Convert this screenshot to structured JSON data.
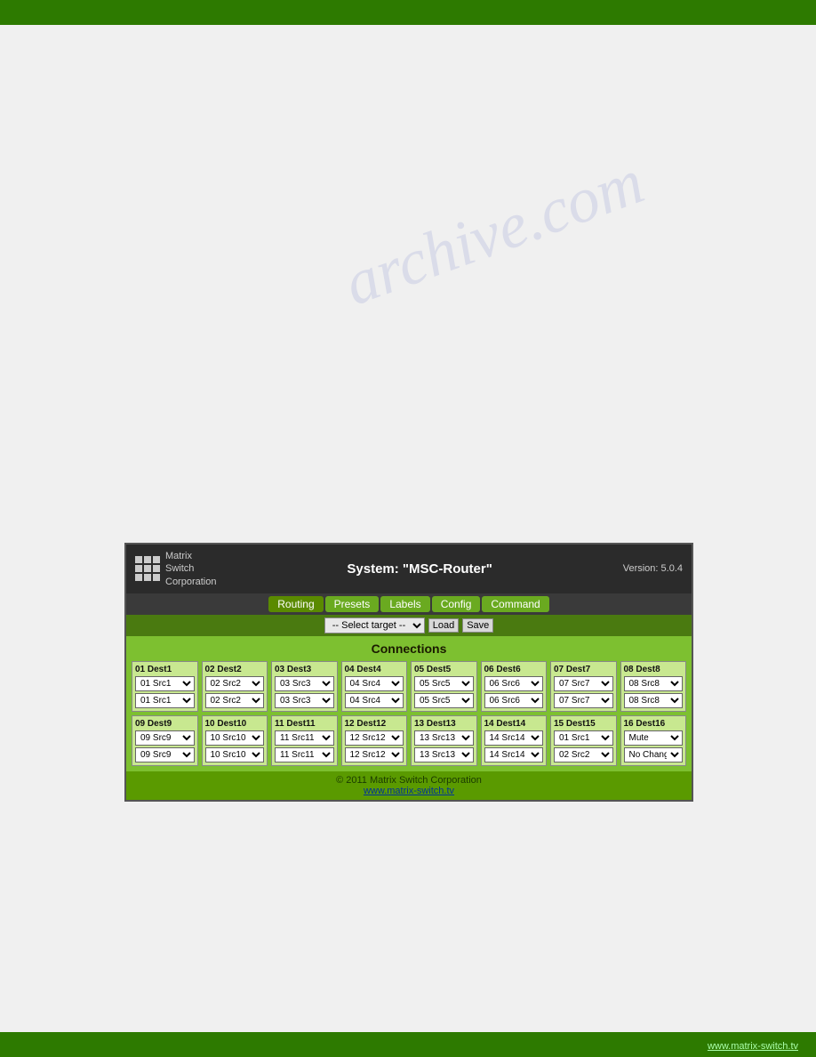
{
  "topBar": {},
  "bottomBar": {
    "text": "www.matrix-switch.tv"
  },
  "watermark": "archive.com",
  "panel": {
    "systemTitle": "System: \"MSC-Router\"",
    "version": "Version: 5.0.4",
    "logo": {
      "lines": [
        "Matrix",
        "Switch",
        "Corporation"
      ]
    },
    "nav": {
      "tabs": [
        {
          "label": "Routing",
          "active": true
        },
        {
          "label": "Presets",
          "active": false
        },
        {
          "label": "Labels",
          "active": false
        },
        {
          "label": "Config",
          "active": false
        },
        {
          "label": "Command",
          "active": false
        }
      ]
    },
    "toolbar": {
      "selectLabel": "-- Select target --",
      "loadButton": "Load",
      "saveButton": "Save"
    },
    "connections": {
      "title": "Connections",
      "destinations": [
        {
          "label": "01 Dest1",
          "selects": [
            "01 Src1",
            "01 Src1"
          ]
        },
        {
          "label": "02 Dest2",
          "selects": [
            "02 Src2",
            "02 Src2"
          ]
        },
        {
          "label": "03 Dest3",
          "selects": [
            "03 Src3",
            "03 Src3"
          ]
        },
        {
          "label": "04 Dest4",
          "selects": [
            "04 Src4",
            "04 Src4"
          ]
        },
        {
          "label": "05 Dest5",
          "selects": [
            "05 Src5",
            "05 Src5"
          ]
        },
        {
          "label": "06 Dest6",
          "selects": [
            "06 Src6",
            "06 Src6"
          ]
        },
        {
          "label": "07 Dest7",
          "selects": [
            "07 Src7",
            "07 Src7"
          ]
        },
        {
          "label": "08 Dest8",
          "selects": [
            "08 Src8",
            "08 Src8"
          ]
        },
        {
          "label": "09 Dest9",
          "selects": [
            "09 Src9",
            "09 Src9"
          ]
        },
        {
          "label": "10 Dest10",
          "selects": [
            "10 Src10",
            "10 Src10"
          ]
        },
        {
          "label": "11 Dest11",
          "selects": [
            "11 Src11",
            "11 Src11"
          ]
        },
        {
          "label": "12 Dest12",
          "selects": [
            "12 Src12",
            "12 Src12"
          ]
        },
        {
          "label": "13 Dest13",
          "selects": [
            "13 Src13",
            "13 Src13"
          ]
        },
        {
          "label": "14 Dest14",
          "selects": [
            "14 Src14",
            "14 Src14"
          ]
        },
        {
          "label": "15 Dest15",
          "selects": [
            "01 Src1",
            "02 Src2"
          ]
        },
        {
          "label": "16 Dest16",
          "selects": [
            "Mute",
            "No Change"
          ]
        }
      ]
    },
    "footer": {
      "copyright": "© 2011 Matrix Switch Corporation",
      "link": "www.matrix-switch.tv"
    }
  }
}
